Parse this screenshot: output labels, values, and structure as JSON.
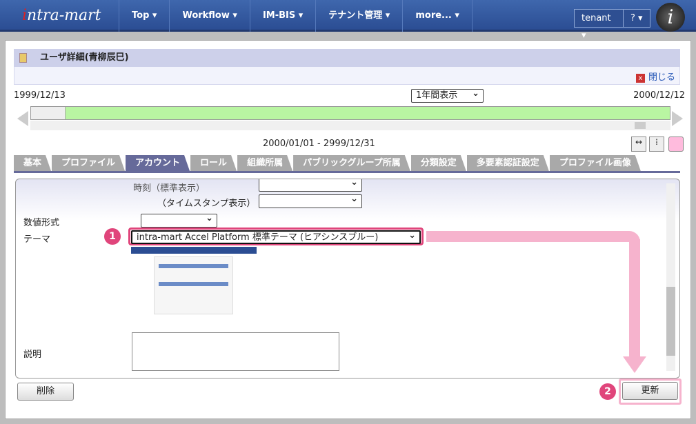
{
  "header": {
    "logo": "intra-mart",
    "nav": [
      "Top ▾",
      "Workflow ▾",
      "IM-BIS ▾",
      "テナント管理 ▾",
      "more... ▾"
    ],
    "tenant": "tenant ▾",
    "help": "? ▾"
  },
  "page": {
    "title": "ユーザ詳細(青柳辰巳)",
    "close": "閉じる"
  },
  "timeline": {
    "start": "1999/12/13",
    "end": "2000/12/12",
    "range_select": "1年間表示",
    "period": "2000/01/01 - 2999/12/31"
  },
  "tabs": [
    "基本",
    "プロファイル",
    "アカウント",
    "ロール",
    "組織所属",
    "パブリックグループ所属",
    "分類設定",
    "多要素認証設定",
    "プロファイル画像"
  ],
  "active_tab": "アカウント",
  "form": {
    "time_label": "時刻（標準表示）",
    "timestamp_label": "（タイムスタンプ表示）",
    "number_label": "数値形式",
    "theme_label": "テーマ",
    "theme_value": "intra-mart Accel Platform 標準テーマ (ヒアシンスブルー)",
    "desc_label": "説明"
  },
  "buttons": {
    "delete": "削除",
    "update": "更新"
  },
  "badges": [
    "1",
    "2"
  ],
  "colors": {
    "header": "#2b4d93",
    "accent": "#e0457b",
    "timeline": "#b9f5a2"
  }
}
